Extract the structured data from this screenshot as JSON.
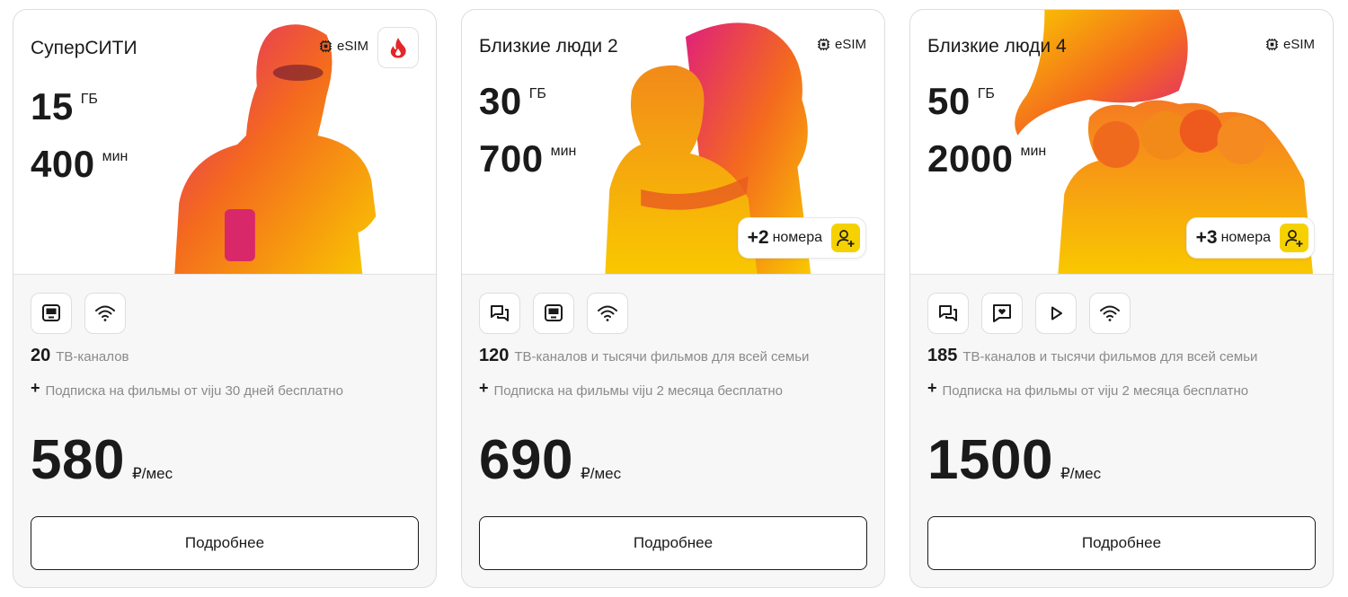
{
  "colors": {
    "photo_yellow": "#f9c800",
    "photo_orange": "#f46a1e",
    "photo_magenta": "#e0207a",
    "accent_yellow": "#f6d100",
    "fire_red": "#e3262a"
  },
  "cards": [
    {
      "name": "СуперСИТИ",
      "esim": "eSIM",
      "gb": "15",
      "gb_unit": "ГБ",
      "min": "400",
      "min_unit": "мин",
      "badge_icon": "fire-icon",
      "features": [
        "tv-icon",
        "wifi-icon"
      ],
      "tv_count": "20",
      "tv_text": "ТВ-каналов",
      "sub_plus": "+",
      "subscription": "Подписка на фильмы от viju 30 дней бесплатно",
      "price": "580",
      "price_unit": "₽/мес",
      "button": "Подробнее"
    },
    {
      "name": "Близкие люди 2",
      "esim": "eSIM",
      "gb": "30",
      "gb_unit": "ГБ",
      "min": "700",
      "min_unit": "мин",
      "extra_plus": "+2",
      "extra_label": "номера",
      "features": [
        "chat-icon",
        "tv-icon",
        "wifi-icon"
      ],
      "tv_count": "120",
      "tv_text": "ТВ-каналов и тысячи фильмов для всей семьи",
      "sub_plus": "+",
      "subscription": "Подписка на фильмы viju 2 месяца бесплатно",
      "price": "690",
      "price_unit": "₽/мес",
      "button": "Подробнее"
    },
    {
      "name": "Близкие люди 4",
      "esim": "eSIM",
      "gb": "50",
      "gb_unit": "ГБ",
      "min": "2000",
      "min_unit": "мин",
      "extra_plus": "+3",
      "extra_label": "номера",
      "features": [
        "chat-icon",
        "heart-message-icon",
        "play-icon",
        "wifi-icon"
      ],
      "tv_count": "185",
      "tv_text": "ТВ-каналов и тысячи фильмов для всей семьи",
      "sub_plus": "+",
      "subscription": "Подписка на фильмы от viju 2 месяца бесплатно",
      "price": "1500",
      "price_unit": "₽/мес",
      "button": "Подробнее"
    }
  ]
}
